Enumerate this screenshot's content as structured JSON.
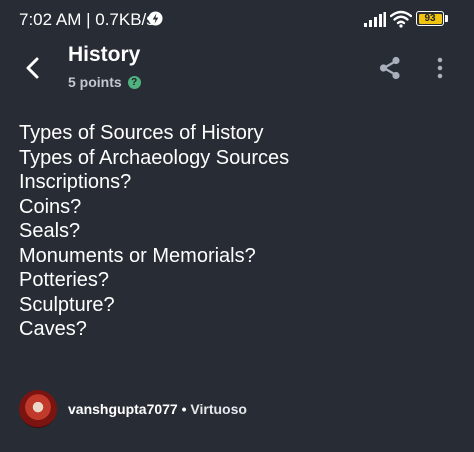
{
  "status_bar": {
    "time_speed": "7:02 AM | 0.7KB/s",
    "battery": "93",
    "icons": [
      "bolt-icon",
      "signal-icon",
      "wifi-icon",
      "battery-icon"
    ]
  },
  "header": {
    "back_icon": "chevron-left-icon",
    "title": "History",
    "points": "5 points",
    "points_help_icon": "?",
    "share_icon": "share-icon",
    "more_icon": "more-vertical-icon"
  },
  "question": {
    "lines": [
      "Types of Sources of History",
      "Types of Archaeology Sources",
      "Inscriptions?",
      "Coins?",
      "Seals?",
      "Monuments or Memorials?",
      "Potteries?",
      "Sculpture?",
      "Caves?"
    ]
  },
  "author": {
    "username": "vanshgupta7077",
    "separator": "•",
    "rank": "Virtuoso"
  },
  "colors": {
    "background": "#272c35",
    "text": "#ffffff",
    "muted": "#c3c8d0",
    "accent_green": "#4fb27f",
    "battery_yellow": "#f1c40f"
  }
}
